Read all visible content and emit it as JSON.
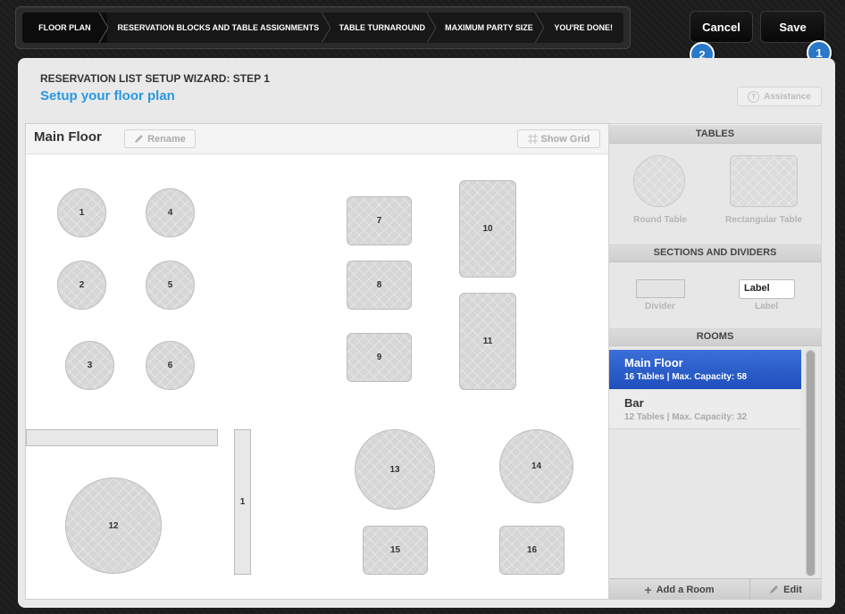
{
  "wizard": {
    "steps": [
      {
        "label": "FLOOR PLAN",
        "active": true
      },
      {
        "label": "RESERVATION BLOCKS AND TABLE ASSIGNMENTS",
        "active": false
      },
      {
        "label": "TABLE TURNAROUND",
        "active": false
      },
      {
        "label": "MAXIMUM PARTY SIZE",
        "active": false
      },
      {
        "label": "YOU'RE DONE!",
        "active": false
      }
    ]
  },
  "actions": {
    "cancel_label": "Cancel",
    "save_label": "Save",
    "cancel_badge": "2",
    "save_badge": "1"
  },
  "header": {
    "step_label": "RESERVATION LIST SETUP WIZARD: STEP 1",
    "title": "Setup your floor plan",
    "assistance_label": "Assistance"
  },
  "floor": {
    "room_name": "Main Floor",
    "rename_label": "Rename",
    "show_grid_label": "Show Grid",
    "tables": [
      "1",
      "2",
      "3",
      "4",
      "5",
      "6",
      "7",
      "8",
      "9",
      "10",
      "11",
      "12",
      "13",
      "14",
      "15",
      "16"
    ],
    "divider_label": "1"
  },
  "side": {
    "tables_heading": "TABLES",
    "round_table_label": "Round Table",
    "rect_table_label": "Rectangular Table",
    "sections_heading": "SECTIONS AND DIVIDERS",
    "divider_label": "Divider",
    "label_tool_text": "Label",
    "label_label": "Label",
    "rooms_heading": "ROOMS",
    "rooms": [
      {
        "name": "Main Floor",
        "detail": "16 Tables | Max. Capacity: 58",
        "selected": true
      },
      {
        "name": "Bar",
        "detail": "12 Tables | Max. Capacity: 32",
        "selected": false
      }
    ],
    "add_room_label": "Add a Room",
    "edit_label": "Edit"
  },
  "colors": {
    "accent": "#2a97e0",
    "selected_room": "#2450c4",
    "badge": "#2a78c8"
  }
}
